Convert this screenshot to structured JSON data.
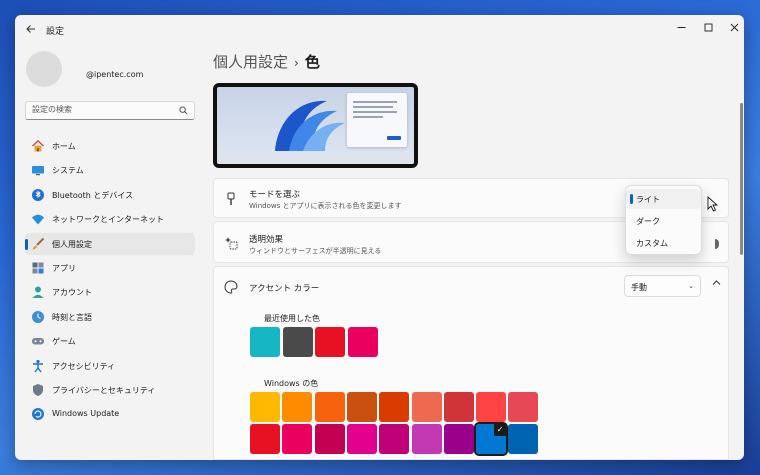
{
  "window": {
    "title": "設定"
  },
  "profile": {
    "email": "@ipentec.com"
  },
  "search": {
    "placeholder": "設定の検索"
  },
  "sidebar": {
    "items": [
      {
        "label": "ホーム",
        "icon": "home-icon"
      },
      {
        "label": "システム",
        "icon": "system-icon"
      },
      {
        "label": "Bluetooth とデバイス",
        "icon": "bluetooth-icon"
      },
      {
        "label": "ネットワークとインターネット",
        "icon": "network-icon"
      },
      {
        "label": "個人用設定",
        "icon": "brush-icon",
        "active": true
      },
      {
        "label": "アプリ",
        "icon": "apps-icon"
      },
      {
        "label": "アカウント",
        "icon": "account-icon"
      },
      {
        "label": "時刻と言語",
        "icon": "time-language-icon"
      },
      {
        "label": "ゲーム",
        "icon": "gaming-icon"
      },
      {
        "label": "アクセシビリティ",
        "icon": "accessibility-icon"
      },
      {
        "label": "プライバシーとセキュリティ",
        "icon": "shield-icon"
      },
      {
        "label": "Windows Update",
        "icon": "windows-update-icon"
      }
    ]
  },
  "breadcrumb": {
    "parent": "個人用設定",
    "separator": "›",
    "current": "色"
  },
  "mode_card": {
    "title": "モードを選ぶ",
    "desc": "Windows とアプリに表示される色を変更します"
  },
  "transparency_card": {
    "title": "透明効果",
    "desc": "ウィンドウとサーフェスが半透明に見える"
  },
  "accent_card": {
    "title": "アクセント カラー",
    "select_value": "手動"
  },
  "mode_dropdown": {
    "options": [
      "ライト",
      "ダーク",
      "カスタム"
    ],
    "selected": "ライト"
  },
  "recent_colors": {
    "label": "最近使用した色",
    "colors": [
      "#17b6c4",
      "#4a4a4a",
      "#e81123",
      "#ea005e"
    ]
  },
  "windows_colors": {
    "label": "Windows の色",
    "row1": [
      "#ffb900",
      "#ff8c00",
      "#f7630c",
      "#ca5010",
      "#da3b01",
      "#ef6950",
      "#d13438",
      "#ff4343",
      "#e74856"
    ],
    "row2": [
      "#e81123",
      "#ea005e",
      "#c30052",
      "#e3008c",
      "#bf0077",
      "#c239b3",
      "#9a0089",
      "#0078d4",
      "#0063b1"
    ],
    "selected": "#0078d4"
  },
  "accent_color": "#0a62c4"
}
